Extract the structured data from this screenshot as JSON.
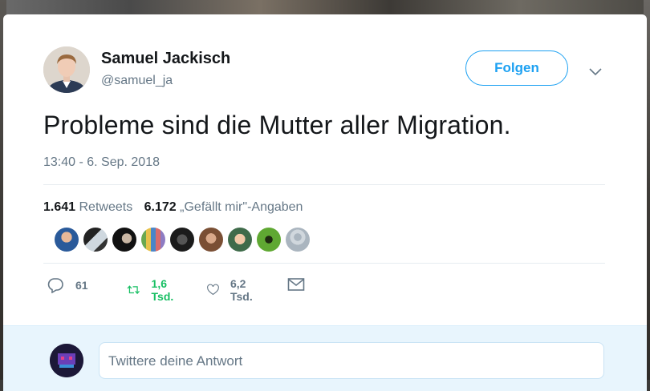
{
  "tweet": {
    "author_name": "Samuel Jackisch",
    "author_handle": "@samuel_ja",
    "follow_label": "Folgen",
    "text": "Probleme sind die Mutter aller Migration.",
    "timestamp": "13:40 - 6. Sep. 2018",
    "retweet_count": "1.641",
    "retweet_label": "Retweets",
    "like_count": "6.172",
    "like_label": "„Gefällt mir\"-Angaben"
  },
  "actions": {
    "reply_count": "61",
    "retweet_count": "1,6 Tsd.",
    "like_count": "6,2 Tsd."
  },
  "reply_box": {
    "placeholder": "Twittere deine Antwort"
  },
  "colors": {
    "accent": "#1da1f2",
    "retweet_green": "#17bf63",
    "text_primary": "#14171a",
    "text_secondary": "#657786"
  },
  "icons": [
    "chevron-down-icon",
    "reply-icon",
    "retweet-icon",
    "heart-icon",
    "message-icon"
  ]
}
